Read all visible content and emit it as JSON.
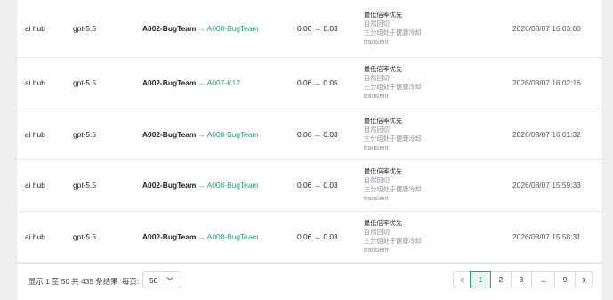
{
  "rows": [
    {
      "provider": "ai hub",
      "model": "gpt-5.5",
      "from": "A002-BugTeam",
      "arrow": "→",
      "to": "A008-BugTeam",
      "ratio": "0.06 → 0.03",
      "reason": [
        "最低倍率优先",
        "自然回切",
        "主分组处于健康冷却",
        "transient"
      ],
      "time": "2026/08/07 16:03:00"
    },
    {
      "provider": "ai hub",
      "model": "gpt-5.5",
      "from": "A002-BugTeam",
      "arrow": "→",
      "to": "A007-K12",
      "ratio": "0.06 → 0.05",
      "reason": [
        "最低倍率优先",
        "自然回切",
        "主分组处于健康冷却",
        "transient"
      ],
      "time": "2026/08/07 16:02:16"
    },
    {
      "provider": "ai hub",
      "model": "gpt-5.5",
      "from": "A002-BugTeam",
      "arrow": "→",
      "to": "A008-BugTeam",
      "ratio": "0.06 → 0.03",
      "reason": [
        "最低倍率优先",
        "自然回切",
        "主分组处于健康冷却",
        "transient"
      ],
      "time": "2026/08/07 16:01:32"
    },
    {
      "provider": "ai hub",
      "model": "gpt-5.5",
      "from": "A002-BugTeam",
      "arrow": "→",
      "to": "A008-BugTeam",
      "ratio": "0.06 → 0.03",
      "reason": [
        "最低倍率优先",
        "自然回切",
        "主分组处于健康冷却",
        "transient"
      ],
      "time": "2026/08/07 15:59:33"
    },
    {
      "provider": "ai hub",
      "model": "gpt-5.5",
      "from": "A002-BugTeam",
      "arrow": "→",
      "to": "A008-BugTeam",
      "ratio": "0.06 → 0.03",
      "reason": [
        "最低倍率优先",
        "自然回切",
        "主分组处于健康冷却",
        "transient"
      ],
      "time": "2026/08/07 15:58:31"
    }
  ],
  "pagination": {
    "summary": "显示 1 至 50 共 435 条结果",
    "per_page_label": "每页:",
    "per_page_value": "50",
    "pages": [
      "1",
      "2",
      "3",
      "...",
      "9"
    ],
    "active_page": "1",
    "prev_icon": "chevron-left-icon",
    "next_icon": "chevron-right-icon"
  },
  "colors": {
    "accent": "#26a17b",
    "active_bg": "#e9f6f1"
  }
}
